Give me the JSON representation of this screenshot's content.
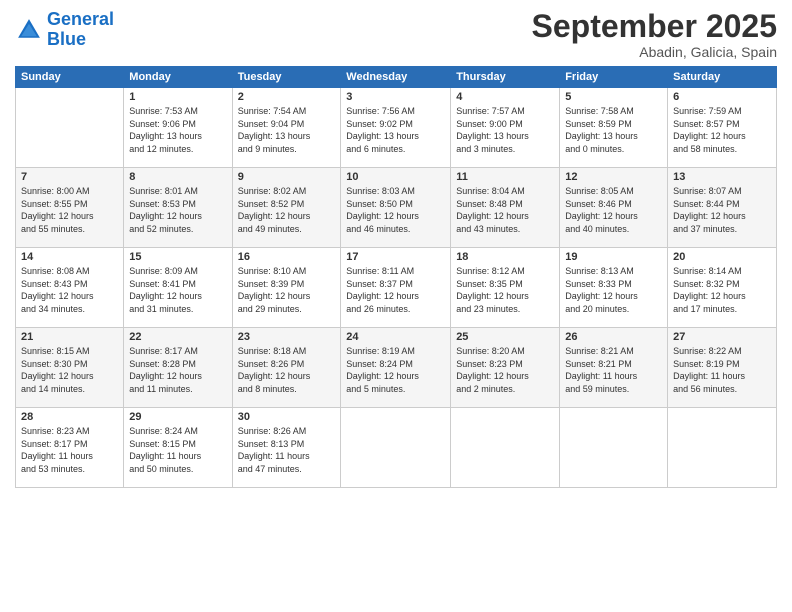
{
  "header": {
    "logo_line1": "General",
    "logo_line2": "Blue",
    "month": "September 2025",
    "location": "Abadin, Galicia, Spain"
  },
  "weekdays": [
    "Sunday",
    "Monday",
    "Tuesday",
    "Wednesday",
    "Thursday",
    "Friday",
    "Saturday"
  ],
  "weeks": [
    [
      {
        "day": "",
        "info": ""
      },
      {
        "day": "1",
        "info": "Sunrise: 7:53 AM\nSunset: 9:06 PM\nDaylight: 13 hours\nand 12 minutes."
      },
      {
        "day": "2",
        "info": "Sunrise: 7:54 AM\nSunset: 9:04 PM\nDaylight: 13 hours\nand 9 minutes."
      },
      {
        "day": "3",
        "info": "Sunrise: 7:56 AM\nSunset: 9:02 PM\nDaylight: 13 hours\nand 6 minutes."
      },
      {
        "day": "4",
        "info": "Sunrise: 7:57 AM\nSunset: 9:00 PM\nDaylight: 13 hours\nand 3 minutes."
      },
      {
        "day": "5",
        "info": "Sunrise: 7:58 AM\nSunset: 8:59 PM\nDaylight: 13 hours\nand 0 minutes."
      },
      {
        "day": "6",
        "info": "Sunrise: 7:59 AM\nSunset: 8:57 PM\nDaylight: 12 hours\nand 58 minutes."
      }
    ],
    [
      {
        "day": "7",
        "info": "Sunrise: 8:00 AM\nSunset: 8:55 PM\nDaylight: 12 hours\nand 55 minutes."
      },
      {
        "day": "8",
        "info": "Sunrise: 8:01 AM\nSunset: 8:53 PM\nDaylight: 12 hours\nand 52 minutes."
      },
      {
        "day": "9",
        "info": "Sunrise: 8:02 AM\nSunset: 8:52 PM\nDaylight: 12 hours\nand 49 minutes."
      },
      {
        "day": "10",
        "info": "Sunrise: 8:03 AM\nSunset: 8:50 PM\nDaylight: 12 hours\nand 46 minutes."
      },
      {
        "day": "11",
        "info": "Sunrise: 8:04 AM\nSunset: 8:48 PM\nDaylight: 12 hours\nand 43 minutes."
      },
      {
        "day": "12",
        "info": "Sunrise: 8:05 AM\nSunset: 8:46 PM\nDaylight: 12 hours\nand 40 minutes."
      },
      {
        "day": "13",
        "info": "Sunrise: 8:07 AM\nSunset: 8:44 PM\nDaylight: 12 hours\nand 37 minutes."
      }
    ],
    [
      {
        "day": "14",
        "info": "Sunrise: 8:08 AM\nSunset: 8:43 PM\nDaylight: 12 hours\nand 34 minutes."
      },
      {
        "day": "15",
        "info": "Sunrise: 8:09 AM\nSunset: 8:41 PM\nDaylight: 12 hours\nand 31 minutes."
      },
      {
        "day": "16",
        "info": "Sunrise: 8:10 AM\nSunset: 8:39 PM\nDaylight: 12 hours\nand 29 minutes."
      },
      {
        "day": "17",
        "info": "Sunrise: 8:11 AM\nSunset: 8:37 PM\nDaylight: 12 hours\nand 26 minutes."
      },
      {
        "day": "18",
        "info": "Sunrise: 8:12 AM\nSunset: 8:35 PM\nDaylight: 12 hours\nand 23 minutes."
      },
      {
        "day": "19",
        "info": "Sunrise: 8:13 AM\nSunset: 8:33 PM\nDaylight: 12 hours\nand 20 minutes."
      },
      {
        "day": "20",
        "info": "Sunrise: 8:14 AM\nSunset: 8:32 PM\nDaylight: 12 hours\nand 17 minutes."
      }
    ],
    [
      {
        "day": "21",
        "info": "Sunrise: 8:15 AM\nSunset: 8:30 PM\nDaylight: 12 hours\nand 14 minutes."
      },
      {
        "day": "22",
        "info": "Sunrise: 8:17 AM\nSunset: 8:28 PM\nDaylight: 12 hours\nand 11 minutes."
      },
      {
        "day": "23",
        "info": "Sunrise: 8:18 AM\nSunset: 8:26 PM\nDaylight: 12 hours\nand 8 minutes."
      },
      {
        "day": "24",
        "info": "Sunrise: 8:19 AM\nSunset: 8:24 PM\nDaylight: 12 hours\nand 5 minutes."
      },
      {
        "day": "25",
        "info": "Sunrise: 8:20 AM\nSunset: 8:23 PM\nDaylight: 12 hours\nand 2 minutes."
      },
      {
        "day": "26",
        "info": "Sunrise: 8:21 AM\nSunset: 8:21 PM\nDaylight: 11 hours\nand 59 minutes."
      },
      {
        "day": "27",
        "info": "Sunrise: 8:22 AM\nSunset: 8:19 PM\nDaylight: 11 hours\nand 56 minutes."
      }
    ],
    [
      {
        "day": "28",
        "info": "Sunrise: 8:23 AM\nSunset: 8:17 PM\nDaylight: 11 hours\nand 53 minutes."
      },
      {
        "day": "29",
        "info": "Sunrise: 8:24 AM\nSunset: 8:15 PM\nDaylight: 11 hours\nand 50 minutes."
      },
      {
        "day": "30",
        "info": "Sunrise: 8:26 AM\nSunset: 8:13 PM\nDaylight: 11 hours\nand 47 minutes."
      },
      {
        "day": "",
        "info": ""
      },
      {
        "day": "",
        "info": ""
      },
      {
        "day": "",
        "info": ""
      },
      {
        "day": "",
        "info": ""
      }
    ]
  ]
}
